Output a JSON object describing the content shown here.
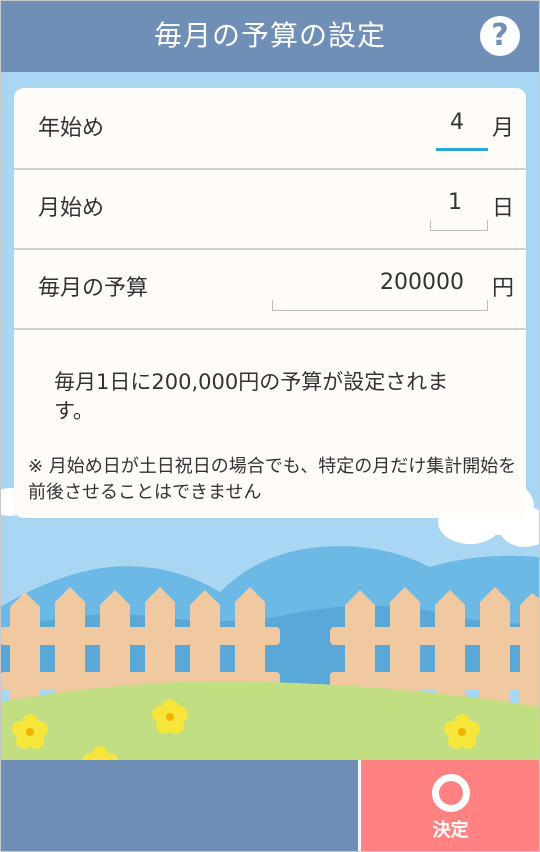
{
  "header": {
    "title": "毎月の予算の設定",
    "help_icon": "question-circle-icon",
    "help_glyph": "?"
  },
  "settings": {
    "year_start": {
      "label": "年始め",
      "value": "4",
      "unit": "月"
    },
    "month_start": {
      "label": "月始め",
      "value": "1",
      "unit": "日"
    },
    "monthly_budget": {
      "label": "毎月の予算",
      "value": "200000",
      "unit": "円"
    }
  },
  "summary_text": "毎月1日に200,000円の予算が設定されます。",
  "note_text": "※ 月始め日が土日祝日の場合でも、特定の月だけ集計開始を前後させることはできません",
  "footer": {
    "decide_label": "決定",
    "decide_icon": "circle-ok-icon"
  },
  "colors": {
    "header": "#6f8fb6",
    "decide_button": "#ff8181",
    "active_underline": "#2aa6d8",
    "sky": "#a9d6f2"
  }
}
